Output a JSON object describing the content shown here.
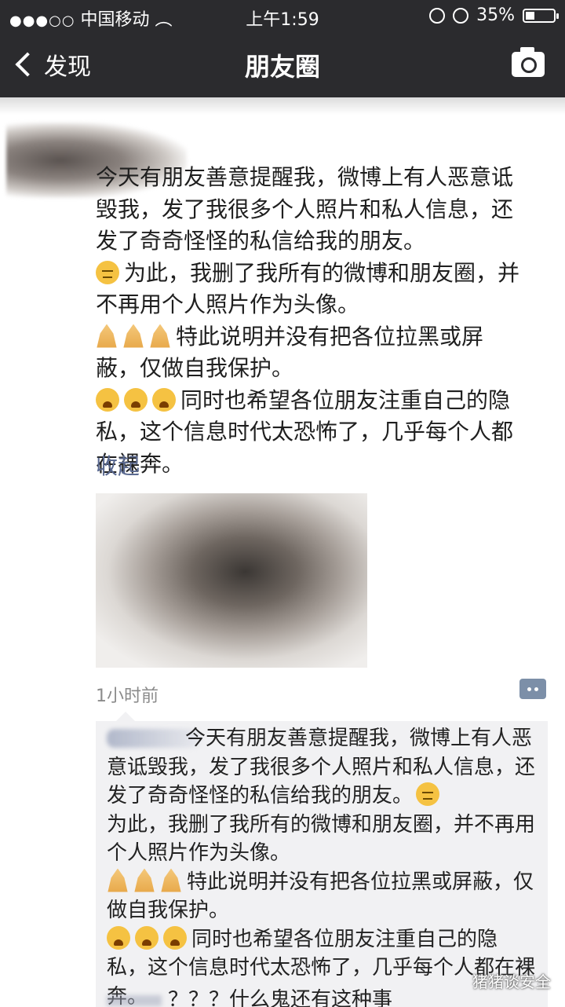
{
  "status_bar": {
    "signal": "●●●○○",
    "carrier": "中国移动",
    "time": "上午1:59",
    "battery": "35%"
  },
  "nav": {
    "back_label": "发现",
    "title": "朋友圈"
  },
  "post": {
    "lines": [
      "今天有朋友善意提醒我，微博上有人恶意诋毁我，发了我很多个人照片和私人信息，还发了奇奇怪怪的私信给我的朋友。",
      "为此，我删了我所有的微博和朋友圈，并不再用个人照片作为头像。",
      "特此说明并没有把各位拉黑或屏蔽，仅做自我保护。",
      "同时也希望各位朋友注重自己的隐私，这个信息时代太恐怖了，几乎每个人都在裸奔。"
    ],
    "collapse_label": "收起",
    "time": "1小时前"
  },
  "comment": {
    "lines": [
      "今天有朋友善意提醒我，微博上有人恶意诋毁我，发了我很多个人照片和私人信息，还发了奇奇怪怪的私信给我的朋友。",
      "为此，我删了我所有的微博和朋友圈，并不再用个人照片作为头像。",
      "特此说明并没有把各位拉黑或屏蔽，仅做自我保护。",
      "同时也希望各位朋友注重自己的隐私，这个信息时代太恐怖了，几乎每个人都在裸奔。"
    ],
    "second": "？？？什么鬼还有这种事"
  },
  "watermark": "猪猪谈安全",
  "icons": {
    "back": "chevron-left-icon",
    "camera": "camera-icon",
    "comment": "comment-icon",
    "wifi": "wifi-icon",
    "alarm": "alarm-icon",
    "lock": "orientation-lock-icon"
  }
}
